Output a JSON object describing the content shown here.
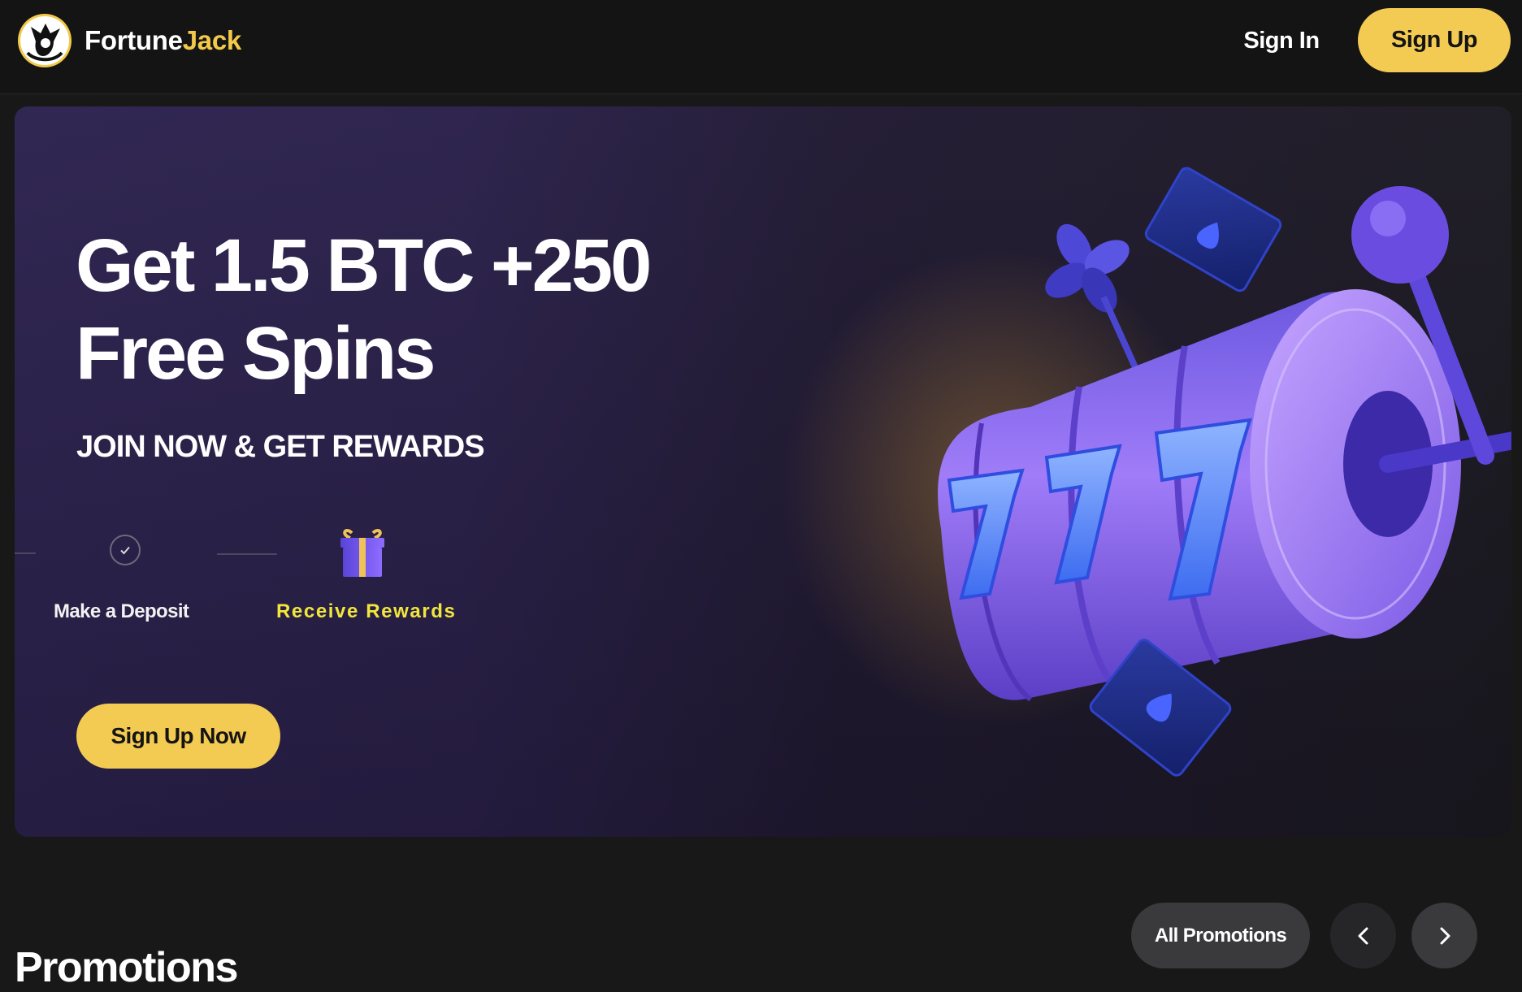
{
  "header": {
    "logo": {
      "part1": "Fortune",
      "part2": "Jack"
    },
    "sign_in": "Sign In",
    "sign_up": "Sign Up"
  },
  "hero": {
    "title_line1": "Get 1.5 BTC +250",
    "title_line2": "Free Spins",
    "subtitle": "JOIN NOW & GET REWARDS",
    "steps": [
      {
        "label": "Make a Deposit",
        "icon": "check-circle-icon"
      },
      {
        "label": "Receive Rewards",
        "icon": "gift-icon"
      }
    ],
    "cta": "Sign Up Now",
    "illustration": "slot-machine-777-illustration"
  },
  "promotions": {
    "title": "Promotions",
    "all_button": "All Promotions",
    "prev_icon": "chevron-left-icon",
    "next_icon": "chevron-right-icon"
  },
  "colors": {
    "accent_yellow": "#f4cb52",
    "rewards_text": "#f1e63c",
    "background": "#181818",
    "hero_purple": "#2d2350"
  }
}
